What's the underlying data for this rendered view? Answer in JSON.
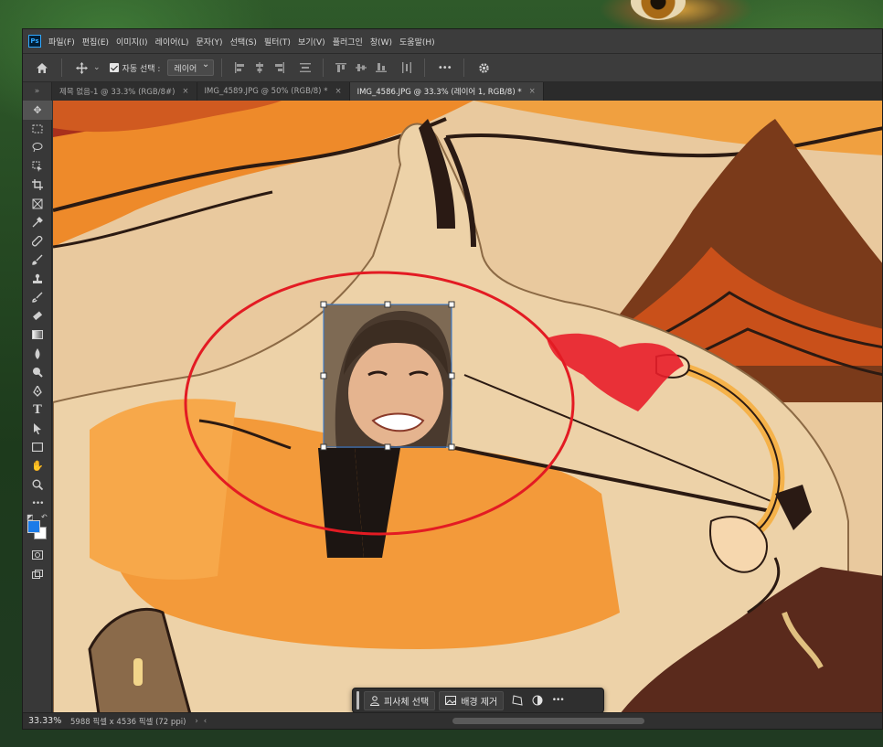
{
  "app": {
    "logo": "Ps",
    "menu": [
      "파일(F)",
      "편집(E)",
      "이미지(I)",
      "레이어(L)",
      "문자(Y)",
      "선택(S)",
      "필터(T)",
      "보기(V)",
      "플러그인",
      "창(W)",
      "도움말(H)"
    ]
  },
  "options": {
    "auto_select_label": "자동 선택 :",
    "auto_select_value": "레이어",
    "more": "•••"
  },
  "tabs": [
    {
      "label": "제목 없음-1 @ 33.3% (RGB/8#)",
      "close": "×"
    },
    {
      "label": "IMG_4589.JPG @ 50% (RGB/8) *",
      "close": "×"
    },
    {
      "label": "IMG_4586.JPG @ 33.3% (레이어 1, RGB/8) *",
      "close": "×"
    }
  ],
  "toolbar": {
    "grip": "»",
    "tools": [
      "move-tool",
      "marquee-tool",
      "lasso-tool",
      "object-select-tool",
      "crop-tool",
      "frame-tool",
      "eyedropper-tool",
      "healing-brush-tool",
      "brush-tool",
      "clone-stamp-tool",
      "history-brush-tool",
      "eraser-tool",
      "gradient-tool",
      "blur-tool",
      "dodge-tool",
      "pen-tool",
      "type-tool",
      "path-select-tool",
      "rectangle-tool",
      "hand-tool",
      "zoom-tool",
      "more-tools"
    ],
    "foreground_color": "#1b7be8",
    "background_color": "#ffffff"
  },
  "status": {
    "zoom": "33.33%",
    "info": "5988 픽셀 x 4536 픽셀 (72 ppi)",
    "arrow": "›"
  },
  "context_bar": {
    "select_subject": "피사체 선택",
    "remove_background": "배경 제거",
    "more": "•••"
  }
}
